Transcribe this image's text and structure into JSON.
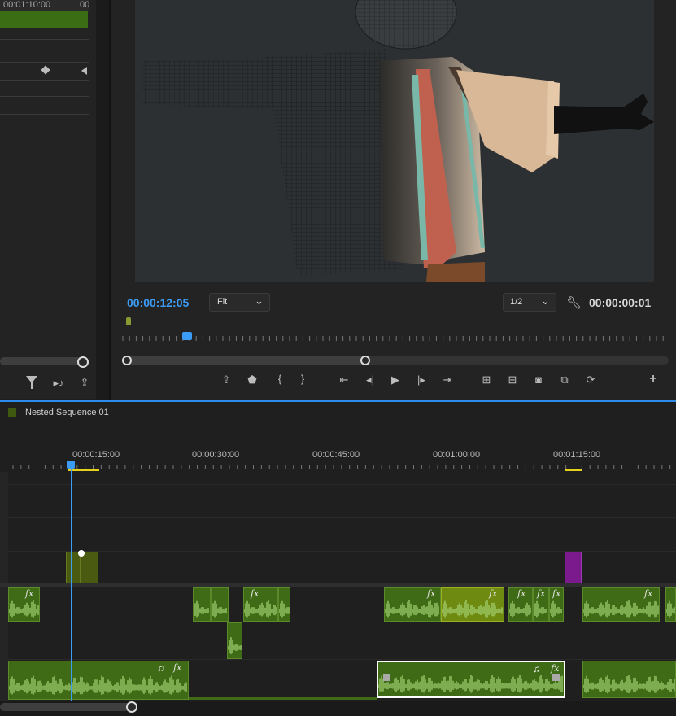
{
  "source_panel": {
    "ruler_time_1": "00:01:10:00",
    "ruler_time_2": "00"
  },
  "program_monitor": {
    "current_time": "00:00:12:05",
    "zoom_select": "Fit",
    "resolution_select": "1/2",
    "duration": "00:00:00:01"
  },
  "timeline": {
    "sequence_name": "Nested Sequence 01",
    "ruler_labels": [
      "00:00:15:00",
      "00:00:30:00",
      "00:00:45:00",
      "00:01:00:00",
      "00:01:15:00"
    ],
    "fx_label": "fx"
  },
  "colors": {
    "accent": "#2d8ceb",
    "timecode": "#3c9cf5",
    "clip_green": "#3f6b16",
    "clip_olive": "#4a5a10",
    "marker_purple": "#7a1a8c",
    "in_out_yellow": "#e6d21a"
  },
  "icons": {
    "filter": "filter-icon",
    "wrench": "wrench-icon",
    "add": "plus-icon"
  }
}
